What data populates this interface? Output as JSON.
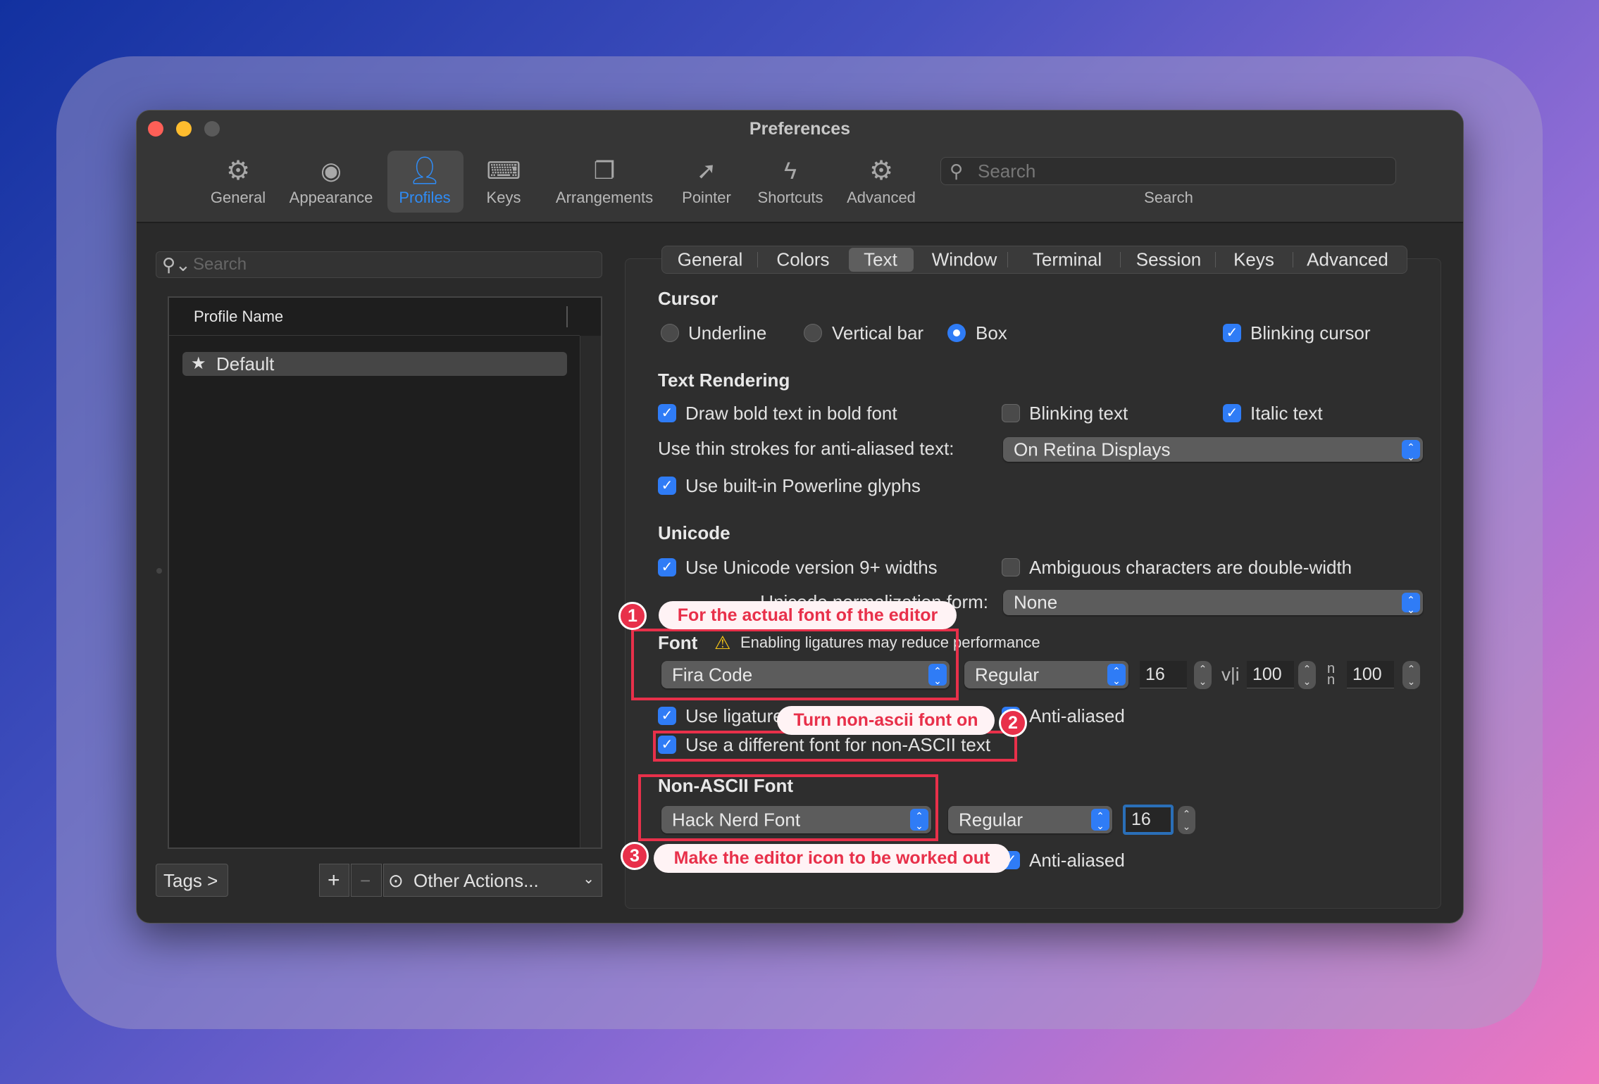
{
  "window": {
    "title": "Preferences"
  },
  "toolbar": {
    "items": [
      {
        "label": "General",
        "icon": "gear-icon"
      },
      {
        "label": "Appearance",
        "icon": "eye-icon"
      },
      {
        "label": "Profiles",
        "icon": "person-icon",
        "selected": true
      },
      {
        "label": "Keys",
        "icon": "keyboard-icon"
      },
      {
        "label": "Arrangements",
        "icon": "windows-icon"
      },
      {
        "label": "Pointer",
        "icon": "pointer-icon"
      },
      {
        "label": "Shortcuts",
        "icon": "bolt-icon"
      },
      {
        "label": "Advanced",
        "icon": "gears-icon"
      }
    ],
    "search_placeholder": "Search",
    "search_label": "Search"
  },
  "sidebar": {
    "search_placeholder": "Search",
    "column_header": "Profile Name",
    "profiles": [
      {
        "name": "Default",
        "starred": true
      }
    ],
    "tags_button": "Tags >",
    "add_button": "+",
    "remove_button": "−",
    "other_actions": "Other Actions..."
  },
  "tabs": [
    "General",
    "Colors",
    "Text",
    "Window",
    "Terminal",
    "Session",
    "Keys",
    "Advanced"
  ],
  "active_tab": "Text",
  "cursor": {
    "heading": "Cursor",
    "options": [
      "Underline",
      "Vertical bar",
      "Box"
    ],
    "selected": "Box",
    "blinking_label": "Blinking cursor",
    "blinking": true
  },
  "text_rendering": {
    "heading": "Text Rendering",
    "bold_label": "Draw bold text in bold font",
    "bold": true,
    "blinking_text_label": "Blinking text",
    "blinking_text": false,
    "italic_label": "Italic text",
    "italic": true,
    "thin_strokes_label": "Use thin strokes for anti-aliased text:",
    "thin_strokes_value": "On Retina Displays",
    "powerline_label": "Use built-in Powerline glyphs",
    "powerline": true
  },
  "unicode": {
    "heading": "Unicode",
    "widths_label": "Use Unicode version 9+ widths",
    "widths": true,
    "ambiguous_label": "Ambiguous characters are double-width",
    "ambiguous": false,
    "normalization_label": "Unicode normalization form:",
    "normalization_value": "None"
  },
  "font": {
    "heading": "Font",
    "warning": "Enabling ligatures may reduce performance",
    "family": "Fira Code",
    "style": "Regular",
    "size": "16",
    "vertical_spacing": "100",
    "horizontal_spacing": "100",
    "vspacing_icon": "v|i",
    "ligatures_label": "Use ligatures",
    "ligatures": true,
    "anti_aliased_label": "Anti-aliased",
    "anti_aliased": true,
    "non_ascii_label": "Use a different font for non-ASCII text",
    "non_ascii": true
  },
  "non_ascii_font": {
    "heading": "Non-ASCII Font",
    "family": "Hack Nerd Font",
    "style": "Regular",
    "size": "16",
    "anti_aliased_label": "Anti-aliased",
    "anti_aliased": true
  },
  "annotations": [
    {
      "number": "1",
      "text": "For the actual font of the editor"
    },
    {
      "number": "2",
      "text": "Turn non-ascii font on"
    },
    {
      "number": "3",
      "text": "Make the editor icon to be worked out"
    }
  ],
  "colors": {
    "accent": "#2f7cf6",
    "annotation": "#e8304a"
  }
}
